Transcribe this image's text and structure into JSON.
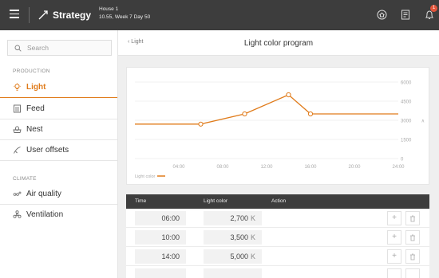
{
  "topbar": {
    "app_title": "Strategy",
    "house_line1": "House 1",
    "house_line2": "10.55, Week 7 Day 50",
    "notification_count": "1"
  },
  "sidebar": {
    "search_placeholder": "Search",
    "section_production": "PRODUCTION",
    "section_climate": "CLIMATE",
    "items": [
      {
        "label": "Light",
        "icon": "bulb-icon",
        "active": true
      },
      {
        "label": "Feed",
        "icon": "feed-icon"
      },
      {
        "label": "Nest",
        "icon": "nest-icon"
      },
      {
        "label": "User offsets",
        "icon": "offsets-icon"
      },
      {
        "label": "Air quality",
        "icon": "air-quality-icon"
      },
      {
        "label": "Ventilation",
        "icon": "ventilation-icon"
      }
    ]
  },
  "main": {
    "back_label": "Light",
    "page_title": "Light color program"
  },
  "chart_data": {
    "type": "line",
    "x_ticks": [
      "04:00",
      "08:00",
      "12:00",
      "16:00",
      "20:00",
      "24:00"
    ],
    "y_ticks": [
      "0",
      "1500",
      "3000",
      "4500",
      "6000"
    ],
    "ylim": [
      0,
      6000
    ],
    "xlim": [
      0,
      24
    ],
    "series": [
      {
        "name": "Light color",
        "color": "#e07b1a",
        "x": [
          0,
          6,
          10,
          14,
          16,
          24
        ],
        "y": [
          2700,
          2700,
          3500,
          5000,
          3500,
          3500
        ],
        "markers": [
          false,
          true,
          true,
          true,
          true,
          false
        ]
      }
    ],
    "grid": true,
    "legend": "bottom-left"
  },
  "table": {
    "headers": {
      "time": "Time",
      "color": "Light color",
      "action": "Action"
    },
    "unit": "K",
    "rows": [
      {
        "time": "06:00",
        "color": "2,700"
      },
      {
        "time": "10:00",
        "color": "3,500"
      },
      {
        "time": "14:00",
        "color": "5,000"
      }
    ]
  },
  "colors": {
    "accent": "#e07b1a",
    "topbar": "#3d3d3d",
    "badge": "#e2543b"
  }
}
